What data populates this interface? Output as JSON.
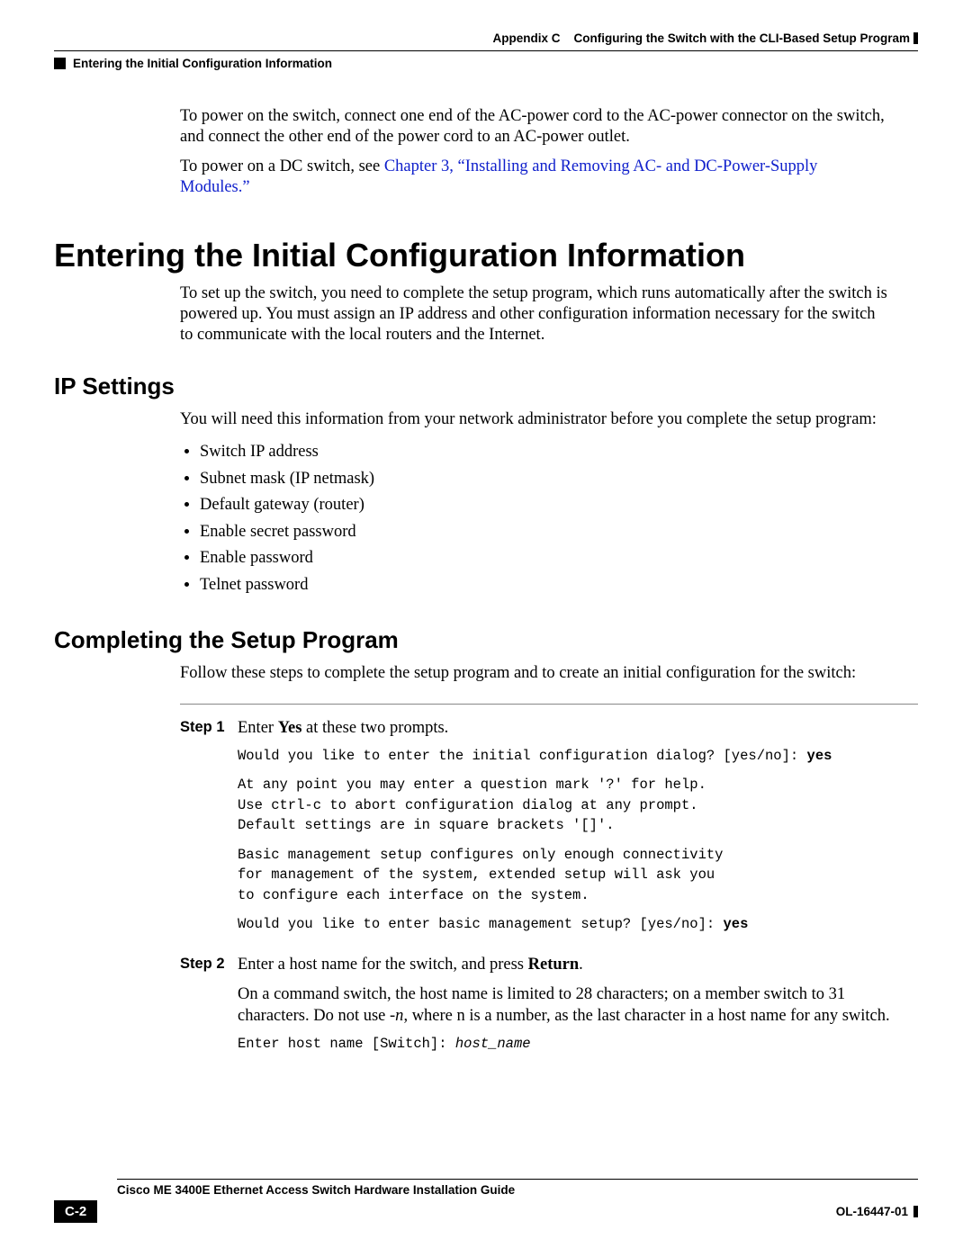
{
  "header": {
    "appendix_label": "Appendix C",
    "appendix_title": "Configuring the Switch with the CLI-Based Setup Program",
    "section_crumb": "Entering the Initial Configuration Information"
  },
  "intro": {
    "para1": "To power on the switch, connect one end of the AC-power cord to the AC-power connector on the switch, and connect the other end of the power cord to an AC-power outlet.",
    "para2_pre": "To power on a DC switch, see ",
    "para2_link": "Chapter 3, “Installing and Removing AC- and DC-Power-Supply Modules.”"
  },
  "h1": "Entering the Initial Configuration Information",
  "h1_para": "To set up the switch, you need to complete the setup program, which runs automatically after the switch is powered up. You must assign an IP address and other configuration information necessary for the switch to communicate with the local routers and the Internet.",
  "ip": {
    "heading": "IP Settings",
    "intro": "You will need this information from your network administrator before you complete the setup program:",
    "items": [
      "Switch IP address",
      "Subnet mask (IP netmask)",
      "Default gateway (router)",
      "Enable secret password",
      "Enable password",
      "Telnet password"
    ]
  },
  "setup": {
    "heading": "Completing the Setup Program",
    "intro": "Follow these steps to complete the setup program and to create an initial configuration for the switch:",
    "step1_label": "Step 1",
    "step1_text_pre": "Enter ",
    "step1_text_bold": "Yes",
    "step1_text_post": " at these two prompts.",
    "step1_cli_line1": "Would you like to enter the initial configuration dialog? [yes/no]: ",
    "step1_cli_line1_ans": "yes",
    "step1_cli_block1": "At any point you may enter a question mark '?' for help.\nUse ctrl-c to abort configuration dialog at any prompt.\nDefault settings are in square brackets '[]'.",
    "step1_cli_block2": "Basic management setup configures only enough connectivity\nfor management of the system, extended setup will ask you\nto configure each interface on the system.",
    "step1_cli_line2": "Would you like to enter basic management setup? [yes/no]: ",
    "step1_cli_line2_ans": "yes",
    "step2_label": "Step 2",
    "step2_text_pre": "Enter a host name for the switch, and press ",
    "step2_text_bold": "Return",
    "step2_text_post": ".",
    "step2_para_pre": "On a command switch, the host name is limited to 28 characters; on a member switch to 31 characters. Do not use ",
    "step2_para_italic": "-n",
    "step2_para_post": ", where n is a number, as the last character in a host name for any switch.",
    "step2_cli_pre": "Enter host name [Switch]: ",
    "step2_cli_var": "host_name"
  },
  "footer": {
    "guide_title": "Cisco ME 3400E Ethernet Access Switch Hardware Installation Guide",
    "page_num": "C-2",
    "doc_id": "OL-16447-01"
  }
}
